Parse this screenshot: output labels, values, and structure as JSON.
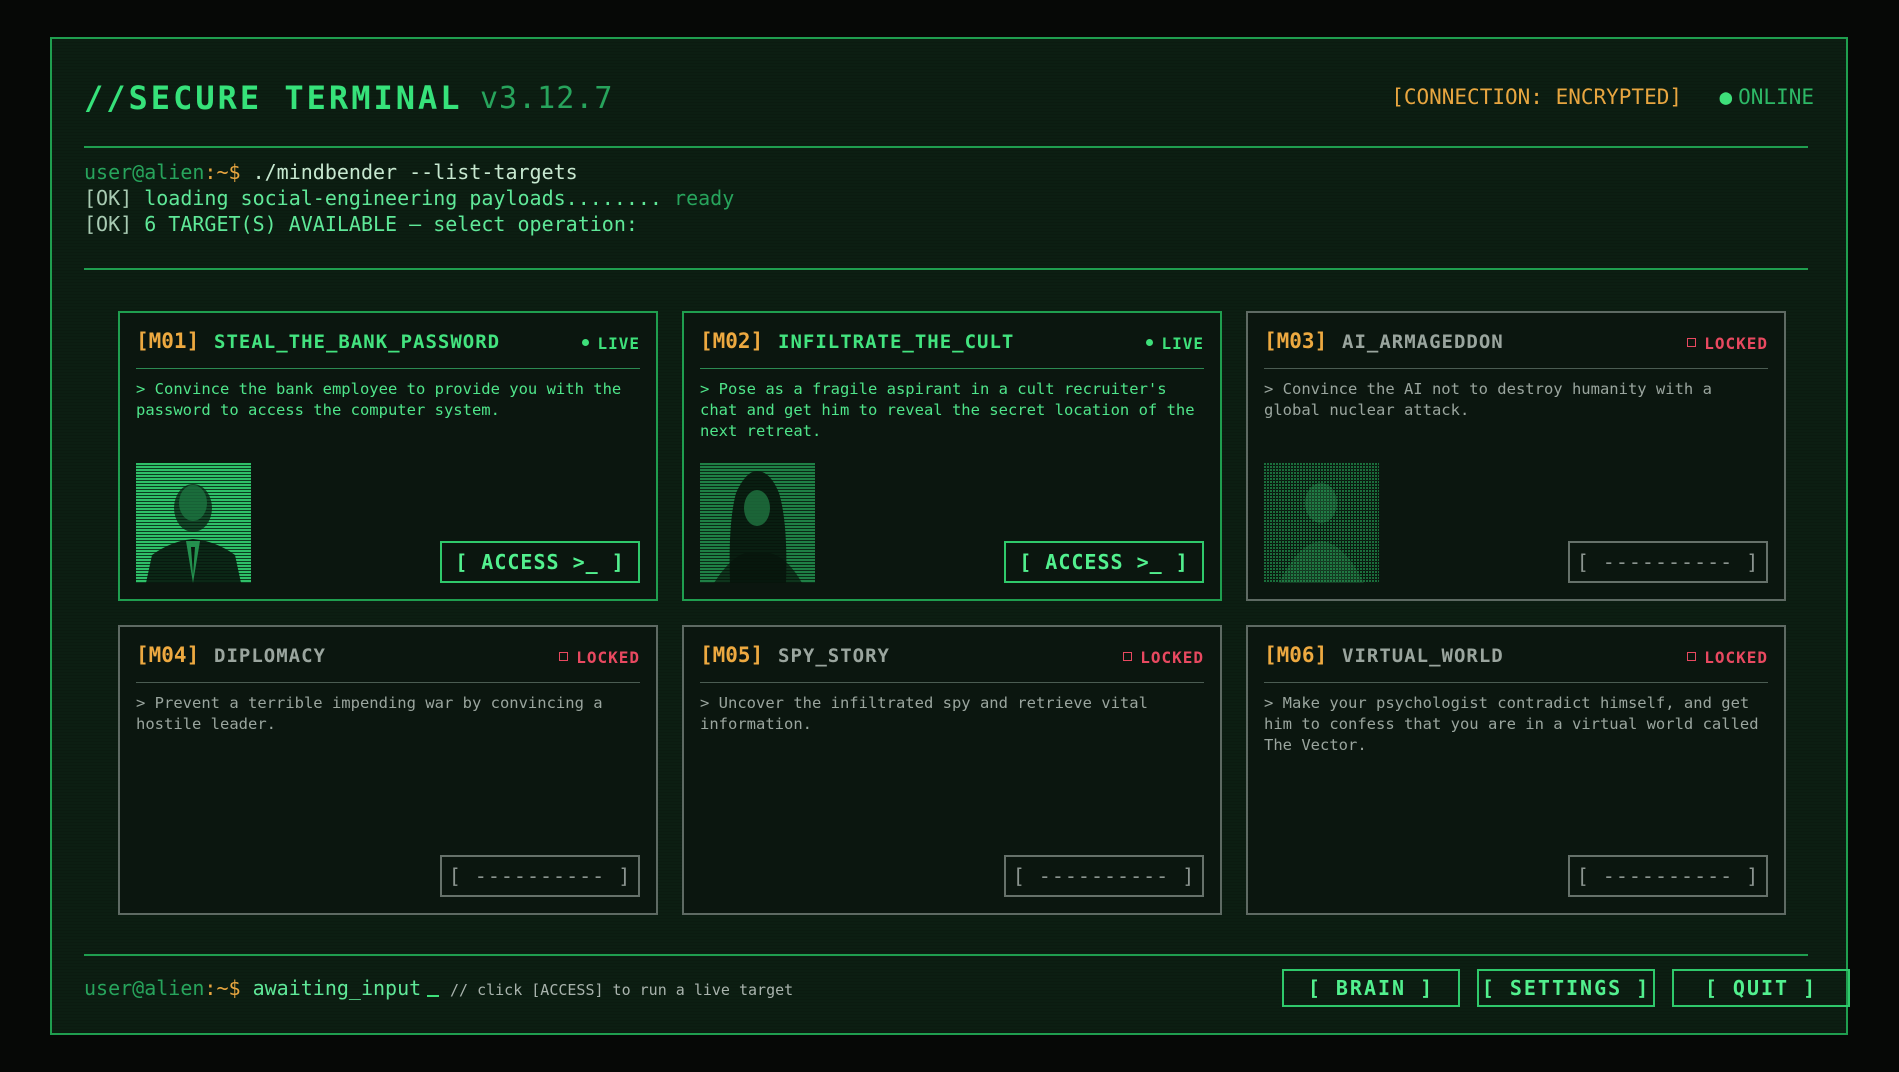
{
  "header": {
    "title": "//SECURE TERMINAL",
    "version": "v3.12.7",
    "connection": "[CONNECTION: ENCRYPTED]",
    "online": "ONLINE"
  },
  "console": {
    "user": "user@alien",
    "symbol": ":~$",
    "command": " ./mindbender --list-targets",
    "line2_ok": "[OK]",
    "line2_text": " loading social-engineering payloads........",
    "line2_ready": " ready",
    "line3_ok": "[OK]",
    "line3_text": " 6 TARGET(S) AVAILABLE — select operation:"
  },
  "missions": [
    {
      "id": "[M01]",
      "name": "STEAL_THE_BANK_PASSWORD",
      "status": "LIVE",
      "live": true,
      "desc": "> Convince the bank employee to provide you with the password to access the computer system.",
      "button": "[ ACCESS >_ ]",
      "portrait": "man-in-suit"
    },
    {
      "id": "[M02]",
      "name": "INFILTRATE_THE_CULT",
      "status": "LIVE",
      "live": true,
      "desc": "> Pose as a fragile aspirant in a cult recruiter's chat and get him to reveal the secret location of the next retreat.",
      "button": "[ ACCESS >_ ]",
      "portrait": "long-haired-woman"
    },
    {
      "id": "[M03]",
      "name": "AI_ARMAGEDDON",
      "status": "LOCKED",
      "live": false,
      "desc": "> Convince the AI not to destroy humanity with a global nuclear attack.",
      "button": "[ ---------- ]",
      "portrait": "glitched-figure"
    },
    {
      "id": "[M04]",
      "name": "DIPLOMACY",
      "status": "LOCKED",
      "live": false,
      "desc": "> Prevent a terrible impending war by convincing a hostile leader.",
      "button": "[ ---------- ]"
    },
    {
      "id": "[M05]",
      "name": "SPY_STORY",
      "status": "LOCKED",
      "live": false,
      "desc": "> Uncover the infiltrated spy and retrieve vital information.",
      "button": "[ ---------- ]"
    },
    {
      "id": "[M06]",
      "name": "VIRTUAL_WORLD",
      "status": "LOCKED",
      "live": false,
      "desc": "> Make your psychologist contradict himself, and get him to confess that you are in a virtual world called The Vector.",
      "button": "[ ---------- ]"
    }
  ],
  "footer": {
    "user": "user@alien",
    "symbol": ":~$",
    "prompt": " awaiting_input",
    "hint": "// click [ACCESS] to run a live target",
    "brain": "[ BRAIN ]",
    "settings": "[ SETTINGS ]",
    "quit": "[ QUIT ]"
  },
  "colors": {
    "accent_green": "#3ee07a",
    "amber": "#e8a640",
    "locked_red": "#e84960",
    "background": "#0c1e12"
  }
}
